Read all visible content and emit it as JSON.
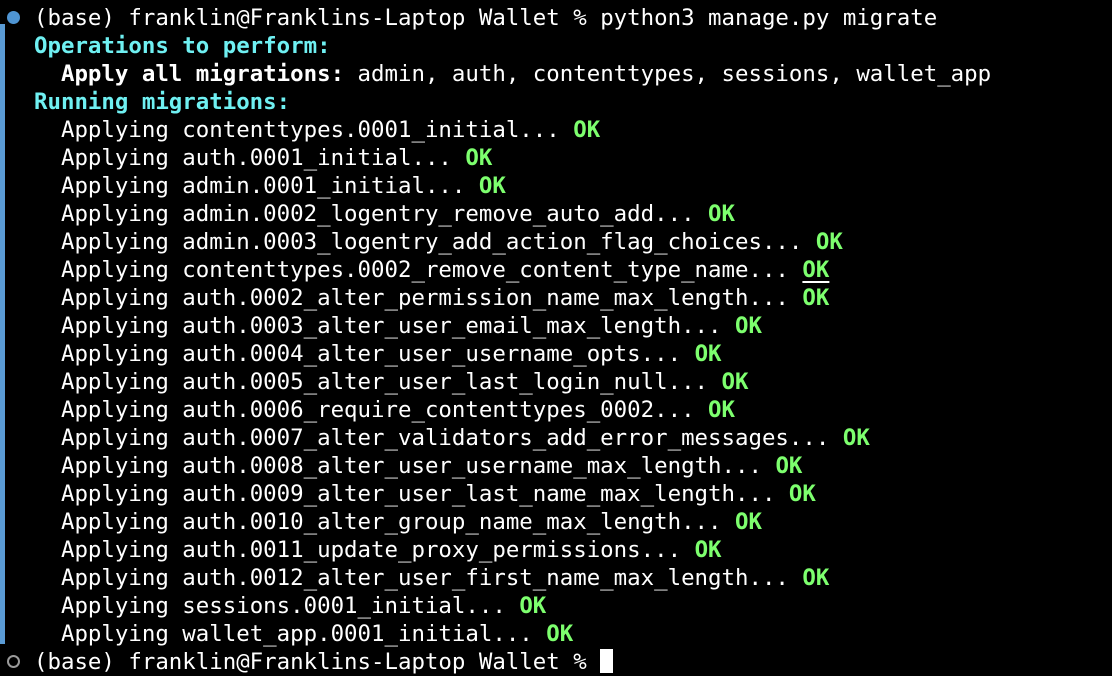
{
  "terminal": {
    "command_prompt": "(base) franklin@Franklins-Laptop Wallet % ",
    "command": "python3 manage.py migrate",
    "operations_header": "Operations to perform:",
    "apply_label": "Apply all migrations:",
    "apply_apps": " admin, auth, contenttypes, sessions, wallet_app",
    "running_header": "Running migrations:",
    "migration_prefix": "Applying ",
    "ok_label": "OK",
    "migrations": [
      "contenttypes.0001_initial... ",
      "auth.0001_initial... ",
      "admin.0001_initial... ",
      "admin.0002_logentry_remove_auto_add... ",
      "admin.0003_logentry_add_action_flag_choices... ",
      "contenttypes.0002_remove_content_type_name... ",
      "auth.0002_alter_permission_name_max_length... ",
      "auth.0003_alter_user_email_max_length... ",
      "auth.0004_alter_user_username_opts... ",
      "auth.0005_alter_user_last_login_null... ",
      "auth.0006_require_contenttypes_0002... ",
      "auth.0007_alter_validators_add_error_messages... ",
      "auth.0008_alter_user_username_max_length... ",
      "auth.0009_alter_user_last_name_max_length... ",
      "auth.0010_alter_group_name_max_length... ",
      "auth.0011_update_proxy_permissions... ",
      "auth.0012_alter_user_first_name_max_length... ",
      "sessions.0001_initial... ",
      "wallet_app.0001_initial... "
    ],
    "final_prompt": "(base) franklin@Franklins-Laptop Wallet % ",
    "colors": {
      "background": "#000000",
      "header_cyan": "#6ff0f2",
      "ok_green": "#7dff6e",
      "marker_blue": "#4f95d3"
    }
  }
}
